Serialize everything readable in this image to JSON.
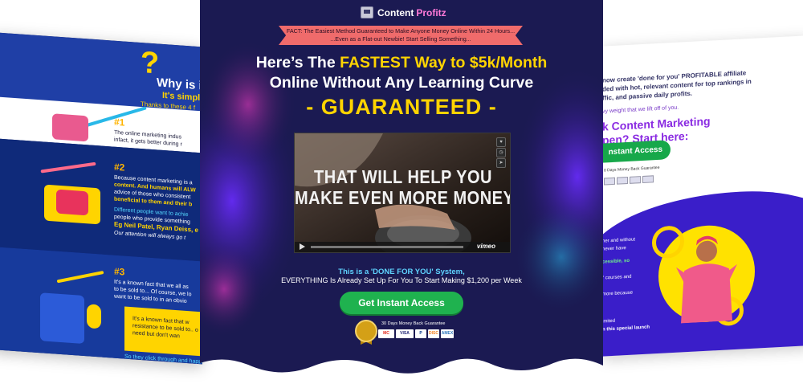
{
  "center": {
    "logo": {
      "word1": "Content",
      "word2": "Profitz",
      "icon": "monitor-icon"
    },
    "fact_line1": "FACT: The Easiest Method Guaranteed to Make Anyone Money Online Within 24 Hours...",
    "fact_line2": "...Even as a Flat-out Newbie! Start Selling Something...",
    "headline_pre": "Here’s The ",
    "headline_highlight": "FASTEST Way to $5k/Month",
    "headline_line2": "Online Without Any Learning Curve",
    "guaranteed": "- GUARANTEED -",
    "video": {
      "line1": "THAT WILL HELP YOU",
      "line2": "MAKE EVEN MORE MONEY",
      "brand": "vimeo",
      "controls": [
        "heart-icon",
        "clock-icon",
        "share-icon"
      ]
    },
    "dfy_line1": "This is a 'DONE FOR YOU' System,",
    "dfy_line2": "EVERYTHING Is Already Set Up For You To Start Making $1,200 per Week",
    "cta_label": "Get Instant Access",
    "guarantee_text": "30 Days Money Back Guarantee",
    "payment_cards": [
      "MC",
      "VISA",
      "P",
      "DISC",
      "AMEX"
    ]
  },
  "left": {
    "question_mark": "?",
    "title": "Why is i",
    "subtitle": "It's simple",
    "thanks": "Thanks to these 4 f",
    "item1": {
      "num": "#1",
      "line1": "The online marketing indus",
      "line2": "infact, it gets better during r"
    },
    "item2": {
      "num": "#2",
      "line1": "Because content marketing is a",
      "line2": "content. And humans will ALW",
      "line3": "advice of those who consistent",
      "line4": "beneficial to them and their b",
      "line5": "Different people want to achie",
      "line6": "people who provide something",
      "line7": "Eg Neil Patel, Ryan Deiss, e",
      "line8": "Our attention will always go t"
    },
    "item3": {
      "num": "#3",
      "line1": "It's a known fact that we all as",
      "line2": "to be sold to... Of course, we lo",
      "line3": "want to be sold to in an obvio",
      "box1": "It's a known fact that w",
      "box2": "resistance to be sold to.. o",
      "box3": "need but don't wan",
      "bottom": "So they click through and happily"
    }
  },
  "right": {
    "intro_line1": "now create 'done for you' PROFITABLE affiliate",
    "intro_line2": "ded with hot, relevant content for top rankings in",
    "intro_line3": "ffic, and passive daily profits.",
    "small_line": "vy weight that we lift off of you.",
    "heading_line1": "k Content Marketing",
    "heading_line2": "pen? Start here:",
    "cta_label": "nstant Access",
    "guarantee": "0 Days Money Back Guarantee",
    "wave_lines": [
      "her and without",
      "never have",
      "cessible, so",
      "\" courses and",
      "more because",
      "imited",
      "n this special launch"
    ]
  }
}
